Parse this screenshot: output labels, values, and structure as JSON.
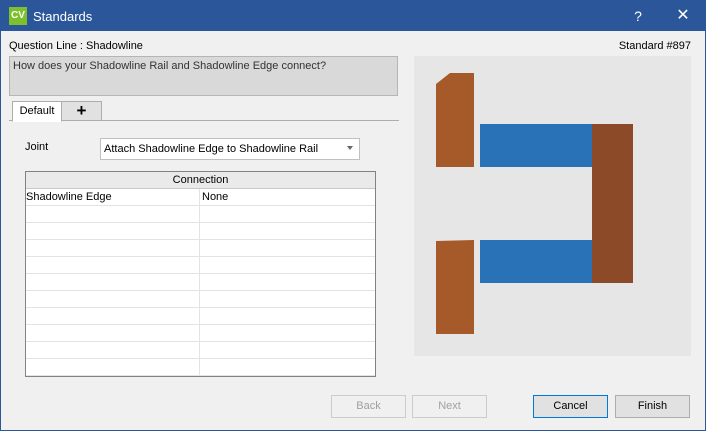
{
  "window": {
    "app_icon_text": "CV",
    "title": "Standards",
    "help_label": "?",
    "close_label": "✕"
  },
  "header": {
    "question_line": "Question Line : Shadowline",
    "standard_number": "Standard #897"
  },
  "question": {
    "text": "How does your Shadowline Rail and Shadowline Edge connect?"
  },
  "tabs": [
    {
      "label": "Default"
    },
    {
      "label": "+"
    }
  ],
  "joint": {
    "label": "Joint",
    "selected": "Attach Shadowline Edge to Shadowline Rail"
  },
  "connection_table": {
    "header": "Connection",
    "rows": [
      {
        "name": "Shadowline Edge",
        "value": "None"
      },
      {
        "name": "",
        "value": ""
      },
      {
        "name": "",
        "value": ""
      },
      {
        "name": "",
        "value": ""
      },
      {
        "name": "",
        "value": ""
      },
      {
        "name": "",
        "value": ""
      },
      {
        "name": "",
        "value": ""
      },
      {
        "name": "",
        "value": ""
      },
      {
        "name": "",
        "value": ""
      },
      {
        "name": "",
        "value": ""
      },
      {
        "name": "",
        "value": ""
      }
    ]
  },
  "preview": {
    "colors": {
      "background": "#e6e6e6",
      "rail_wood": "#a65a2a",
      "frame_wood": "#8c4a28",
      "edge_blue": "#2a72b8"
    }
  },
  "buttons": {
    "back": "Back",
    "next": "Next",
    "cancel": "Cancel",
    "finish": "Finish"
  }
}
